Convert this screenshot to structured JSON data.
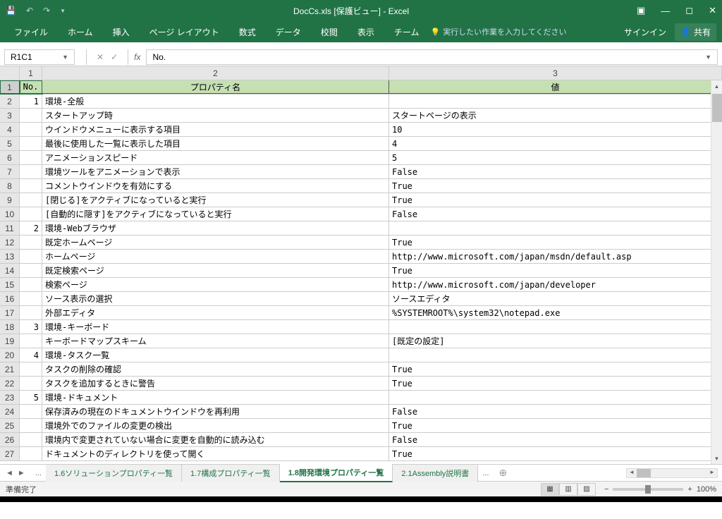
{
  "title": "DocCs.xls  [保護ビュー] - Excel",
  "ribbon": {
    "file": "ファイル",
    "home": "ホーム",
    "insert": "挿入",
    "layout": "ページ レイアウト",
    "formula": "数式",
    "data": "データ",
    "review": "校閲",
    "view": "表示",
    "team": "チーム",
    "tell": "実行したい作業を入力してください",
    "signin": "サインイン",
    "share": "共有"
  },
  "fx": {
    "name": "R1C1",
    "value": "No."
  },
  "cols": [
    "1",
    "2",
    "3"
  ],
  "headers": {
    "no": "No.",
    "prop": "プロパティ名",
    "val": "値"
  },
  "rows": [
    {
      "n": "1",
      "no": "1",
      "p": "環境-全般",
      "v": ""
    },
    {
      "n": "2",
      "no": "",
      "p": "スタートアップ時",
      "v": "スタートページの表示"
    },
    {
      "n": "3",
      "no": "",
      "p": "ウインドウメニューに表示する項目",
      "v": "10"
    },
    {
      "n": "4",
      "no": "",
      "p": "最後に使用した一覧に表示した項目",
      "v": "4"
    },
    {
      "n": "5",
      "no": "",
      "p": "アニメーションスピード",
      "v": "5"
    },
    {
      "n": "6",
      "no": "",
      "p": "環境ツールをアニメーションで表示",
      "v": "False"
    },
    {
      "n": "7",
      "no": "",
      "p": "コメントウインドウを有効にする",
      "v": "True"
    },
    {
      "n": "8",
      "no": "",
      "p": "[閉じる]をアクティブになっていると実行",
      "v": "True"
    },
    {
      "n": "9",
      "no": "",
      "p": "[自動的に隠す]をアクティブになっていると実行",
      "v": "False"
    },
    {
      "n": "10",
      "no": "2",
      "p": "環境-Webブラウザ",
      "v": ""
    },
    {
      "n": "11",
      "no": "",
      "p": "既定ホームページ",
      "v": "True"
    },
    {
      "n": "12",
      "no": "",
      "p": "ホームページ",
      "v": "http://www.microsoft.com/japan/msdn/default.asp"
    },
    {
      "n": "13",
      "no": "",
      "p": "既定検索ページ",
      "v": "True"
    },
    {
      "n": "14",
      "no": "",
      "p": "検索ページ",
      "v": "http://www.microsoft.com/japan/developer"
    },
    {
      "n": "15",
      "no": "",
      "p": "ソース表示の選択",
      "v": "ソースエディタ"
    },
    {
      "n": "16",
      "no": "",
      "p": "外部エディタ",
      "v": "%SYSTEMROOT%\\system32\\notepad.exe"
    },
    {
      "n": "17",
      "no": "3",
      "p": "環境-キーボード",
      "v": ""
    },
    {
      "n": "18",
      "no": "",
      "p": "キーボードマップスキーム",
      "v": "[既定の設定]"
    },
    {
      "n": "19",
      "no": "4",
      "p": "環境-タスク一覧",
      "v": ""
    },
    {
      "n": "20",
      "no": "",
      "p": "タスクの削除の確認",
      "v": "True"
    },
    {
      "n": "21",
      "no": "",
      "p": "タスクを追加するときに警告",
      "v": "True"
    },
    {
      "n": "22",
      "no": "5",
      "p": "環境-ドキュメント",
      "v": ""
    },
    {
      "n": "23",
      "no": "",
      "p": "保存済みの現在のドキュメントウインドウを再利用",
      "v": "False"
    },
    {
      "n": "24",
      "no": "",
      "p": "環境外でのファイルの変更の検出",
      "v": "True"
    },
    {
      "n": "25",
      "no": "",
      "p": "環境内で変更されていない場合に変更を自動的に読み込む",
      "v": "False"
    },
    {
      "n": "26",
      "no": "",
      "p": "ドキュメントのディレクトリを使って開く",
      "v": "True"
    }
  ],
  "sheets": {
    "s1": "1.6ソリューションプロパティ一覧",
    "s2": "1.7構成プロパティ一覧",
    "s3": "1.8開発環境プロパティ一覧",
    "s4": "2.1Assembly説明書"
  },
  "status": {
    "ready": "準備完了",
    "zoom": "100%"
  }
}
